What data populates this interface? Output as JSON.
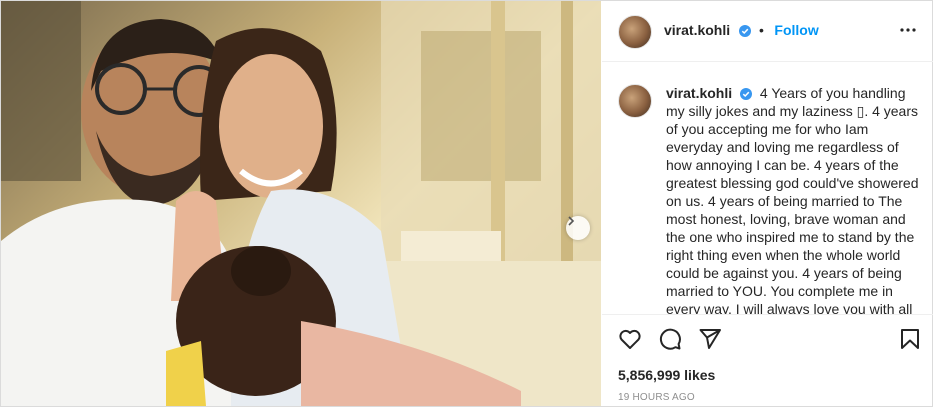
{
  "post": {
    "username": "virat.kohli",
    "follow_label": "Follow",
    "separator": "•",
    "caption_text": "4 Years of you handling my silly jokes and my laziness ▯. 4 years of you accepting me for who Iam everyday and loving me regardless of how annoying I can be. 4 years of the greatest blessing god could've showered on us. 4 years of being married to The most honest, loving, brave woman and the one who inspired me to stand by the right thing even when the whole world could be against you. 4 years of being married to YOU. You complete me in every way. I will always love you with all my heart.",
    "likes": "5,856,999 likes",
    "timestamp": "19 HOURS AGO"
  },
  "colors": {
    "accent": "#0095f6",
    "verified": "#3897f0",
    "text": "#262626",
    "muted": "#8e8e8e",
    "border": "#dbdbdb"
  },
  "icons": {
    "verified": "verified-badge-icon",
    "more": "more-options-icon",
    "like": "heart-icon",
    "comment": "comment-icon",
    "share": "share-icon",
    "save": "bookmark-icon",
    "next": "chevron-right-icon"
  }
}
